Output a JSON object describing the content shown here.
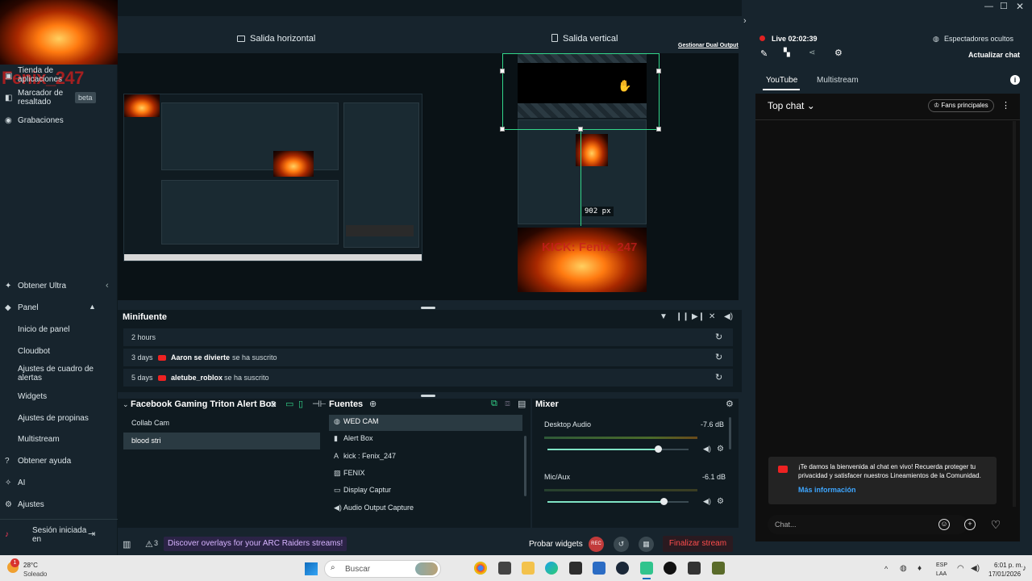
{
  "sidebar": {
    "logo_overlay_text": "Fenix_247",
    "items_top": [
      {
        "label": "Tienda de aplicaciones",
        "icon": "store-icon"
      },
      {
        "label": "Marcador de resaltado",
        "badge": "beta",
        "icon": "bookmark-icon"
      },
      {
        "label": "Grabaciones",
        "icon": "recordings-icon"
      }
    ],
    "get_ultra": "Obtener Ultra",
    "panel": "Panel",
    "panel_items": [
      "Inicio de panel",
      "Cloudbot",
      "Ajustes de cuadro de alertas",
      "Widgets",
      "Ajustes de propinas",
      "Multistream"
    ],
    "get_help": "Obtener ayuda",
    "ai": "AI",
    "settings": "Ajustes",
    "session": "Sesión iniciada en"
  },
  "preview": {
    "horizontal_label": "Salida horizontal",
    "vertical_label": "Salida vertical",
    "dual_output_link": "Gestionar Dual Output",
    "px_readout": "902 px",
    "vertical_overlay_text": "KICK: Fenix_247"
  },
  "minifeed": {
    "title": "Minifuente",
    "rows": [
      {
        "time": "2 hours",
        "user": "",
        "action": ""
      },
      {
        "time": "3 days",
        "user": "Aaron se divierte",
        "action": "se ha suscrito"
      },
      {
        "time": "5 days",
        "user": "aletube_roblox",
        "action": "se ha suscrito"
      }
    ]
  },
  "scenes": {
    "title": "Facebook Gaming Triton Alert Box",
    "items": [
      "Collab Cam",
      "blood stri"
    ]
  },
  "sources": {
    "title": "Fuentes",
    "items": [
      {
        "label": "WED CAM",
        "icon": "globe-icon"
      },
      {
        "label": "Alert Box",
        "icon": "alert-icon"
      },
      {
        "label": "kick : Fenix_247",
        "icon": "text-icon"
      },
      {
        "label": "FENIX",
        "icon": "image-icon"
      },
      {
        "label": "Display Captur",
        "icon": "monitor-icon"
      },
      {
        "label": "Audio Output Capture",
        "icon": "speaker-icon"
      }
    ]
  },
  "mixer": {
    "title": "Mixer",
    "channels": [
      {
        "name": "Desktop Audio",
        "db": "-7.6 dB",
        "level": 0.78
      },
      {
        "name": "Mic/Aux",
        "db": "-6.1 dB",
        "level": 0.82
      }
    ]
  },
  "footer": {
    "badge_count": "3",
    "discover": "Discover overlays for your ARC Raiders streams!",
    "test_widgets": "Probar widgets",
    "rec_label": "REC",
    "end_stream": "Finalizar stream"
  },
  "chat": {
    "live_label": "Live",
    "live_time": "02:02:39",
    "hidden_viewers": "Espectadores ocultos",
    "refresh_chat": "Actualizar chat",
    "tabs": [
      "YouTube",
      "Multistream"
    ],
    "top_chat": "Top chat",
    "top_fans": "Fans principales",
    "notice_text": "¡Te damos la bienvenida al chat en vivo! Recuerda proteger tu privacidad y satisfacer nuestros Lineamientos de la Comunidad.",
    "notice_link": "Más información",
    "input_placeholder": "Chat..."
  },
  "taskbar": {
    "temp": "28°C",
    "weather": "Soleado",
    "search": "Buscar",
    "lang": "ESP",
    "lang2": "LAA",
    "time": "6:01 p. m.",
    "date": "17/01/2026"
  },
  "colors": {
    "accent_green": "#33d68a",
    "live_red": "#e22222",
    "end_red": "#ff4d4d",
    "discover_purple": "#d7b4ff"
  }
}
